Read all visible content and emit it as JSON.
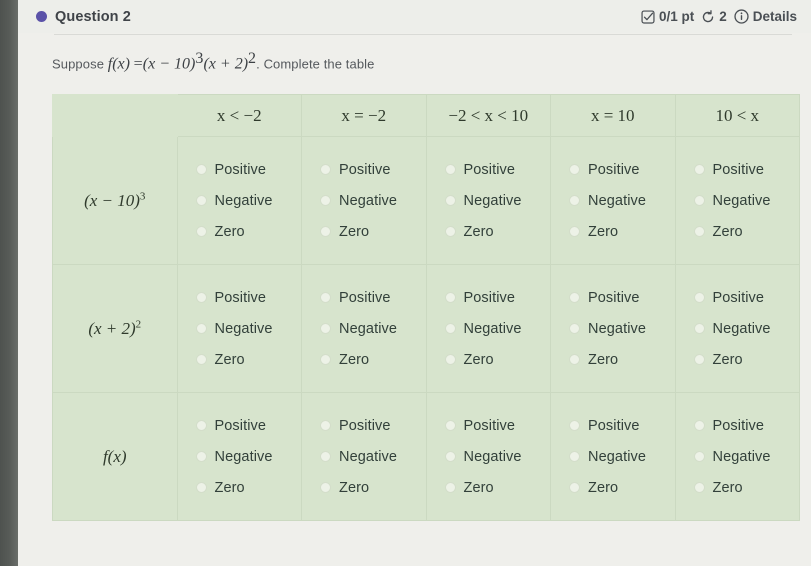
{
  "header": {
    "question_label": "Question 2",
    "dot_color": "#5b52a8",
    "score": "0/1 pt",
    "attempts": "2",
    "details_label": "Details"
  },
  "prompt": {
    "lead": "Suppose",
    "function_lhs": "f(x)",
    "equals": "=",
    "factor_one_base": "(x − 10)",
    "factor_one_exp": "3",
    "factor_two_base": "(x + 2)",
    "factor_two_exp": "2",
    "tail": ". Complete the table"
  },
  "table": {
    "columns": [
      {
        "id": "col-lt-neg2",
        "label": "x < −2"
      },
      {
        "id": "col-eq-neg2",
        "label": "x = −2"
      },
      {
        "id": "col-between",
        "label": "−2 < x < 10"
      },
      {
        "id": "col-eq-10",
        "label": "x = 10"
      },
      {
        "id": "col-gt-10",
        "label": "10 < x"
      }
    ],
    "rows": [
      {
        "id": "row-factor-one",
        "label_base": "(x − 10)",
        "label_exp": "3"
      },
      {
        "id": "row-factor-two",
        "label_base": "(x + 2)",
        "label_exp": "2"
      },
      {
        "id": "row-fx",
        "label_base": "f(x)",
        "label_exp": ""
      }
    ],
    "options": [
      "Positive",
      "Negative",
      "Zero"
    ],
    "selected": null,
    "colors": {
      "cell_bg": "#d7e4cd",
      "grid_line": "#cbd9c1",
      "text": "#32403a"
    }
  },
  "icons": {
    "score": "checkbox-check-icon",
    "attempts": "retry-circular-arrow-icon",
    "details": "info-circle-icon"
  }
}
